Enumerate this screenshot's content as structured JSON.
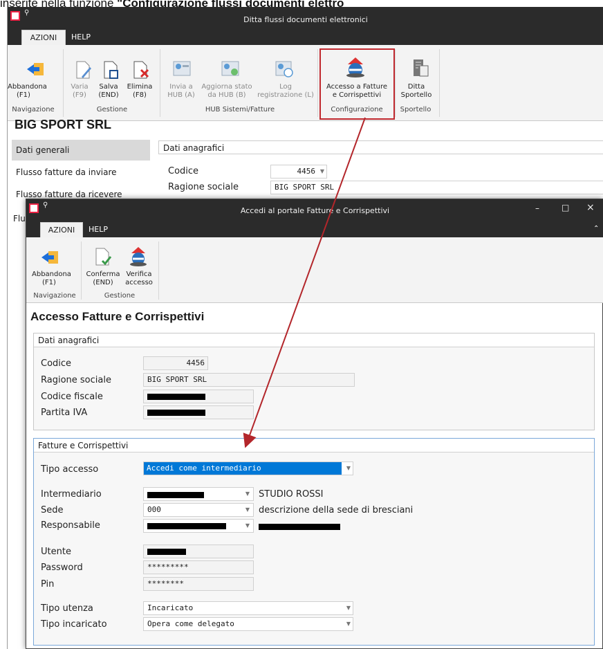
{
  "caption": {
    "prefix": "inserite nella funzione ",
    "bold": "\"Configurazione flussi documenti elettro"
  },
  "back_window": {
    "title": "Ditta flussi documenti elettronici",
    "tabs": [
      "AZIONI",
      "HELP"
    ],
    "ribbon": {
      "buttons": [
        {
          "label": "Abbandona\n(F1)",
          "icon": "exit-arrow-icon"
        },
        {
          "label": "Varia\n(F9)",
          "icon": "edit-pencil-icon"
        },
        {
          "label": "Salva\n(END)",
          "icon": "save-disk-icon"
        },
        {
          "label": "Elimina\n(F8)",
          "icon": "delete-x-icon"
        },
        {
          "label": "Invia a\nHUB (A)",
          "icon": "send-hub-icon"
        },
        {
          "label": "Aggiorna stato\nda HUB (B)",
          "icon": "refresh-hub-icon"
        },
        {
          "label": "Log\nregistrazione (L)",
          "icon": "log-clock-icon"
        },
        {
          "label": "Accesso a Fatture\ne Corrispettivi",
          "icon": "agency-logo-icon"
        },
        {
          "label": "Ditta\nSportello",
          "icon": "building-icon"
        }
      ],
      "groups": [
        "Navigazione",
        "Gestione",
        "HUB Sistemi/Fatture",
        "Configurazione",
        "Sportello"
      ],
      "highlight_color": "#c0282e"
    },
    "company_title": "BIG SPORT SRL",
    "nav_items": [
      "Dati generali",
      "Flusso fatture da inviare",
      "Flusso fatture da ricevere",
      "Flu"
    ],
    "section_title": "Dati anagrafici",
    "fields": {
      "codice_label": "Codice",
      "codice_value": "4456",
      "ragione_label": "Ragione sociale",
      "ragione_value": "BIG SPORT SRL"
    }
  },
  "front_window": {
    "title": "Accedi al portale Fatture e Corrispettivi",
    "controls": [
      "–",
      "□",
      "×"
    ],
    "tabs": [
      "AZIONI",
      "HELP"
    ],
    "ribbon": {
      "buttons": [
        {
          "label": "Abbandona\n(F1)",
          "icon": "exit-arrow-icon"
        },
        {
          "label": "Conferma\n(END)",
          "icon": "confirm-check-icon"
        },
        {
          "label": "Verifica\naccesso",
          "icon": "agency-logo-icon"
        }
      ],
      "groups": [
        "Navigazione",
        "Gestione"
      ]
    },
    "heading": "Accesso Fatture e Corrispettivi",
    "anagrafici": {
      "title": "Dati anagrafici",
      "codice_label": "Codice",
      "codice_value": "4456",
      "ragione_label": "Ragione sociale",
      "ragione_value": "BIG SPORT SRL",
      "cf_label": "Codice fiscale",
      "piva_label": "Partita IVA"
    },
    "fatture": {
      "title": "Fatture e Corrispettivi",
      "tipo_accesso_label": "Tipo accesso",
      "tipo_accesso_value": "Accedi come intermediario",
      "intermediario_label": "Intermediario",
      "intermediario_desc": "STUDIO ROSSI",
      "sede_label": "Sede",
      "sede_value": "000",
      "sede_desc": "descrizione della sede di bresciani",
      "responsabile_label": "Responsabile",
      "utente_label": "Utente",
      "password_label": "Password",
      "password_value": "*********",
      "pin_label": "Pin",
      "pin_value": "********",
      "tipo_utenza_label": "Tipo utenza",
      "tipo_utenza_value": "Incaricato",
      "tipo_incaricato_label": "Tipo incaricato",
      "tipo_incaricato_value": "Opera come delegato"
    },
    "colors": {
      "selection": "#0078d7",
      "section_border": "#7aa7d9",
      "arrow": "#b3262b"
    }
  }
}
